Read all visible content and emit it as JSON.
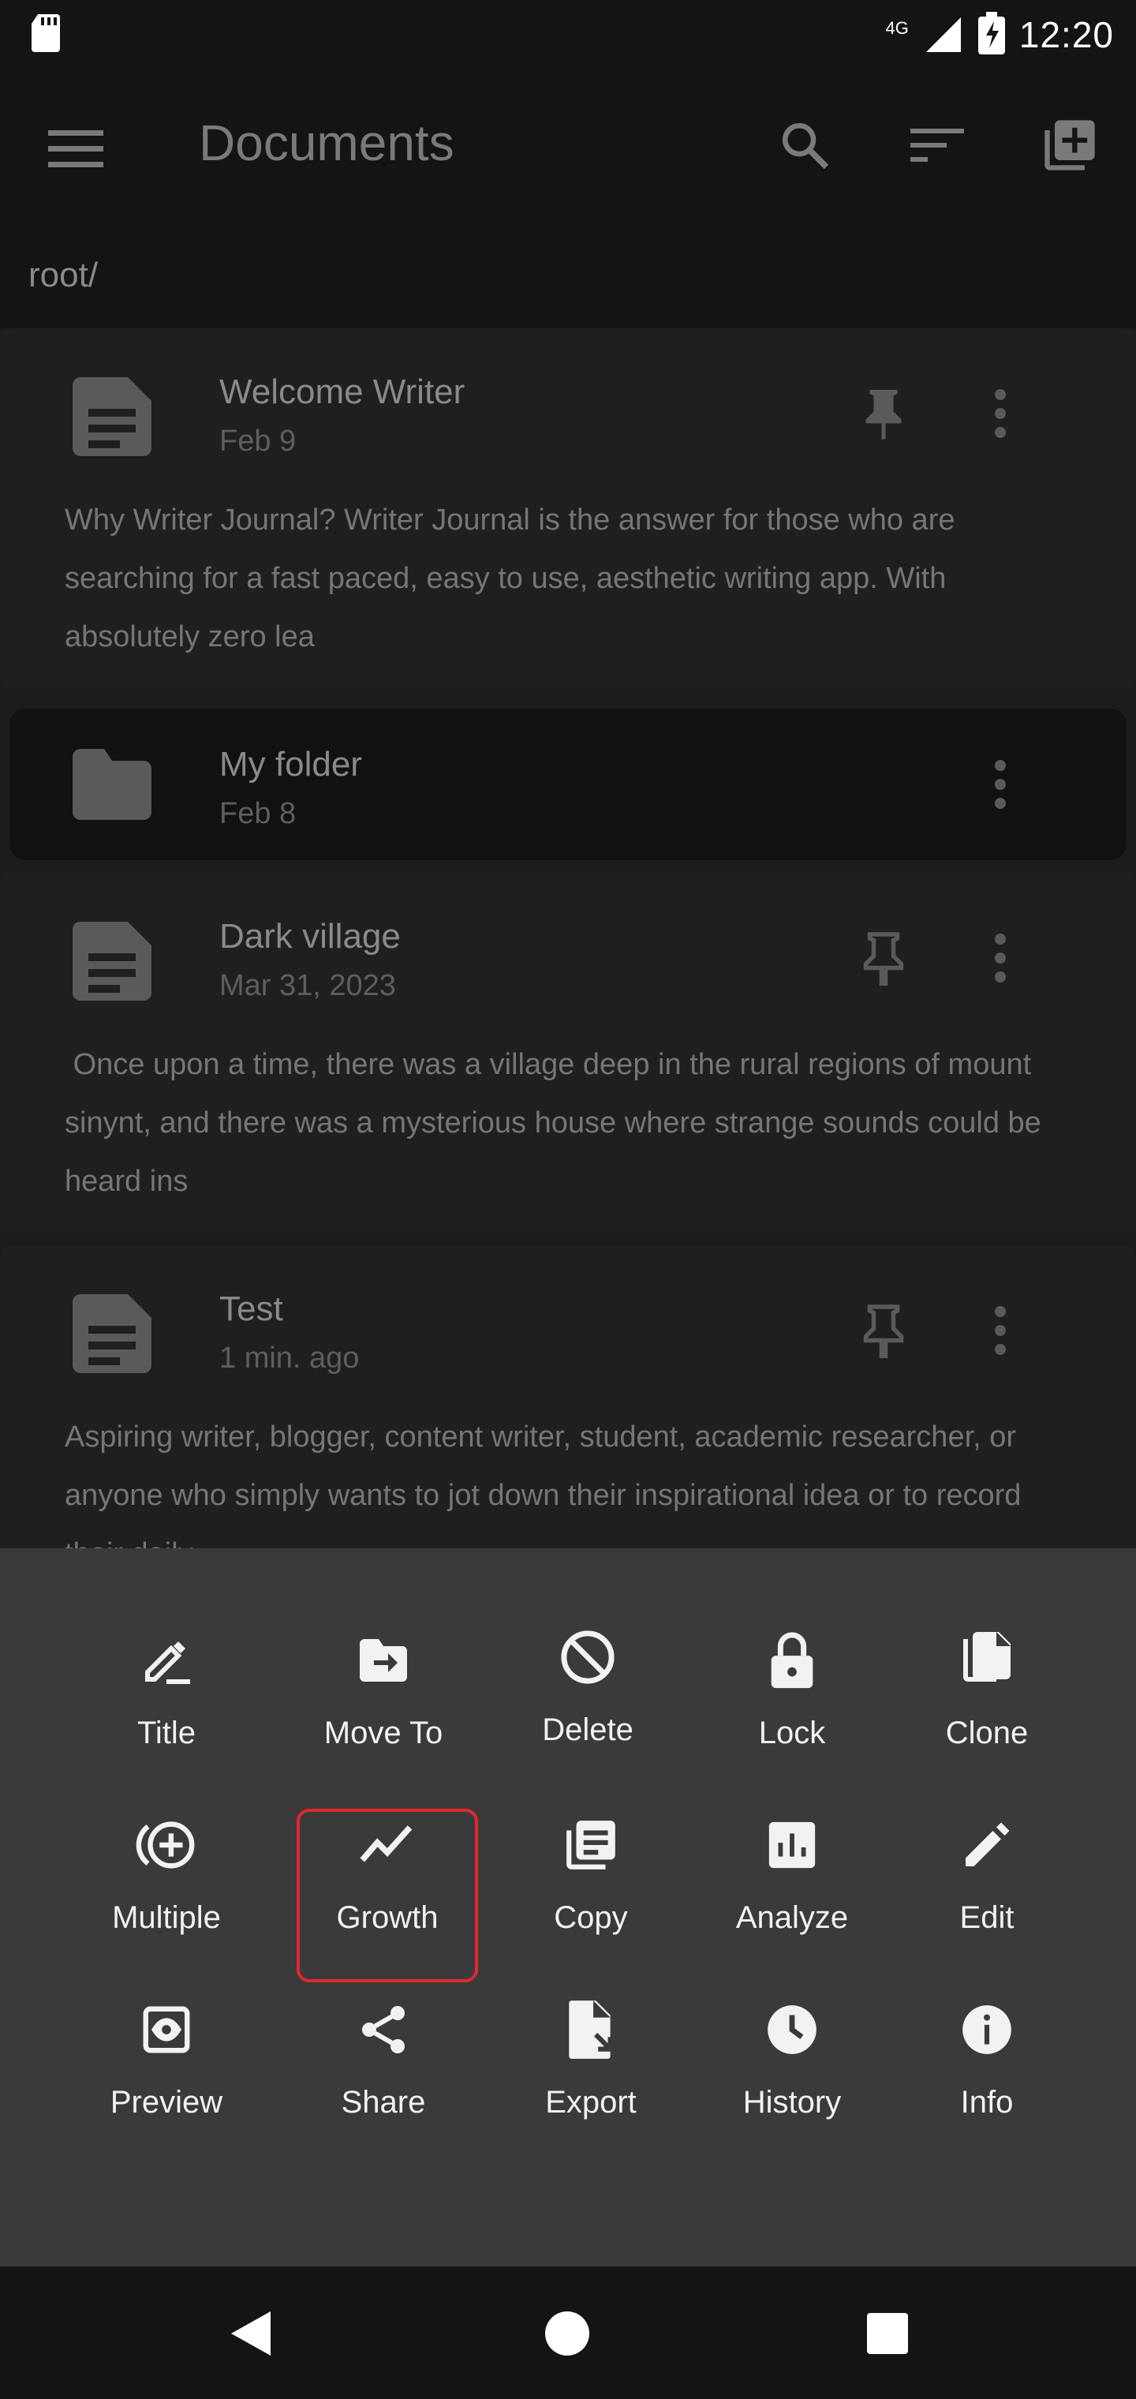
{
  "status_bar": {
    "time": "12:20",
    "network": "4G",
    "icons": [
      "sd-card-icon",
      "signal-icon",
      "battery-charging-icon"
    ]
  },
  "app_bar": {
    "title": "Documents",
    "icons": [
      "menu-icon",
      "search-icon",
      "sort-icon",
      "add-document-icon"
    ]
  },
  "breadcrumb": "root/",
  "documents": [
    {
      "type": "document",
      "title": "Welcome Writer",
      "date": "Feb 9",
      "pinned": true,
      "excerpt": "Why Writer Journal? Writer Journal is the answer for those who are searching for a fast paced, easy to use, aesthetic writing app. With absolutely zero lea"
    },
    {
      "type": "folder",
      "title": "My folder",
      "date": "Feb 8"
    },
    {
      "type": "document",
      "title": "Dark village",
      "date": "Mar 31, 2023",
      "pinned": false,
      "excerpt": " Once upon a time, there was a village deep in the rural regions of mount sinynt, and there was a mysterious house where strange sounds could be heard ins"
    },
    {
      "type": "document",
      "title": "Test",
      "date": "1 min. ago",
      "pinned": false,
      "excerpt": "Aspiring writer, blogger, content writer, student, academic researcher, or anyone who simply wants to jot down their inspirational idea or to record their daily"
    }
  ],
  "actions": [
    {
      "label": "Title",
      "icon": "rename-icon"
    },
    {
      "label": "Move To",
      "icon": "move-to-folder-icon"
    },
    {
      "label": "Delete",
      "icon": "block-icon"
    },
    {
      "label": "Lock",
      "icon": "lock-icon"
    },
    {
      "label": "Clone",
      "icon": "clone-icon"
    },
    {
      "label": "Multiple",
      "icon": "add-circle-icon"
    },
    {
      "label": "Growth",
      "icon": "trending-icon"
    },
    {
      "label": "Copy",
      "icon": "copy-icon"
    },
    {
      "label": "Analyze",
      "icon": "analytics-icon"
    },
    {
      "label": "Edit",
      "icon": "pencil-icon"
    },
    {
      "label": "Preview",
      "icon": "preview-icon"
    },
    {
      "label": "Share",
      "icon": "share-icon"
    },
    {
      "label": "Export",
      "icon": "export-icon"
    },
    {
      "label": "History",
      "icon": "history-icon"
    },
    {
      "label": "Info",
      "icon": "info-icon"
    }
  ],
  "colors": {
    "background": "#1c1c1c",
    "sheet": "#3a3a3a",
    "highlight": "#e0282e"
  },
  "nav_bar": {
    "icons": [
      "back-icon",
      "home-icon",
      "recents-icon"
    ]
  }
}
